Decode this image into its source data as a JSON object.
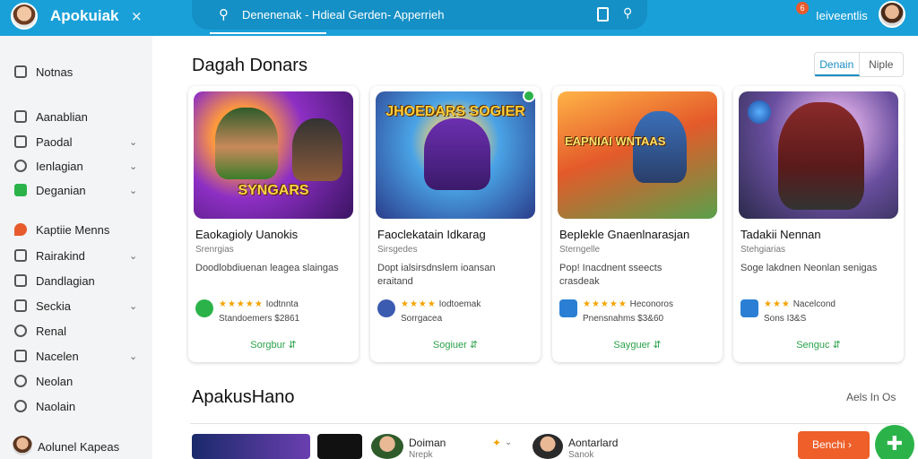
{
  "app": {
    "name": "Apokuiak"
  },
  "search": {
    "text": "Denenenak - Hdieal Gerden- Apperrieh"
  },
  "header": {
    "notification_count": "6",
    "user_name": "Ieiveentlis"
  },
  "sidebar": {
    "items": [
      {
        "label": "Notnas",
        "icon": "home-icon",
        "chevron": false
      },
      {
        "label": "Aanablian",
        "icon": "grid-icon",
        "chevron": false
      },
      {
        "label": "Paodal",
        "icon": "doc-icon",
        "chevron": true
      },
      {
        "label": "Ienlagian",
        "icon": "clock-icon",
        "chevron": true
      },
      {
        "label": "Deganian",
        "icon": "check-icon",
        "chevron": true
      },
      {
        "label": "Kaptiie Menns",
        "icon": "flame-icon",
        "chevron": false
      },
      {
        "label": "Rairakind",
        "icon": "list-icon",
        "chevron": true
      },
      {
        "label": "Dandlagian",
        "icon": "image-icon",
        "chevron": false
      },
      {
        "label": "Seckia",
        "icon": "folder-icon",
        "chevron": true
      },
      {
        "label": "Renal",
        "icon": "circle-icon",
        "chevron": false
      },
      {
        "label": "Nacelen",
        "icon": "table-icon",
        "chevron": true
      },
      {
        "label": "Neolan",
        "icon": "compass-icon",
        "chevron": false
      },
      {
        "label": "Naolain",
        "icon": "settings-icon",
        "chevron": false
      }
    ],
    "footer_name": "Aolunel Kapeas"
  },
  "section1": {
    "title": "Dagah Donars",
    "toggle": [
      "Denain",
      "Niple"
    ]
  },
  "cards": [
    {
      "title": "Eaokagioly Uanokis",
      "sub": "Srenrgias",
      "desc": "Doodlobdiuenan leagea slaingas",
      "art_text": "SYNGARS",
      "rating_text": "Iodtnnta",
      "stars": "★★★★★",
      "meta": "Standoemers $2861",
      "install": "Sorgbur ⇵"
    },
    {
      "title": "Faoclekatain Idkarag",
      "sub": "Sirsgedes",
      "desc": "Dopt ialsirsdnslem ioansan eraitand",
      "art_text": "JHOEDARS SOGIER",
      "rating_text": "Iodtoemak",
      "stars": "★★★★",
      "meta": "Sorrgacea",
      "install": "Sogiuer ⇵"
    },
    {
      "title": "Beplekle Gnaenlnarasjan",
      "sub": "Sterngelle",
      "desc": "Pop! Inacdnent sseects crasdeak",
      "art_text": "EAPNIAI WNTAAS",
      "rating_text": "Heconoros",
      "stars": "★★★★★",
      "meta": "Pnensnahms $3&60",
      "install": "Sayguer ⇵"
    },
    {
      "title": "Tadakii Nennan",
      "sub": "Stehgiarias",
      "desc": "Soge lakdnen Neonlan senigas",
      "art_text": "",
      "rating_text": "Nacelcond",
      "stars": "★★★",
      "meta": "Sons I3&S",
      "install": "Senguc ⇵"
    }
  ],
  "section2": {
    "title": "ApakusHano",
    "see_all": "Aels In Os"
  },
  "bottom_row": {
    "item1_title": "Doiman",
    "item1_sub": "Nrepk",
    "item2_title": "Aontarlard",
    "item2_sub": "Sanok",
    "button": "Benchi ›"
  },
  "colors": {
    "topbar": "#1aa0d8",
    "accent_green": "#2bb34a",
    "accent_orange": "#ee5f2a"
  }
}
